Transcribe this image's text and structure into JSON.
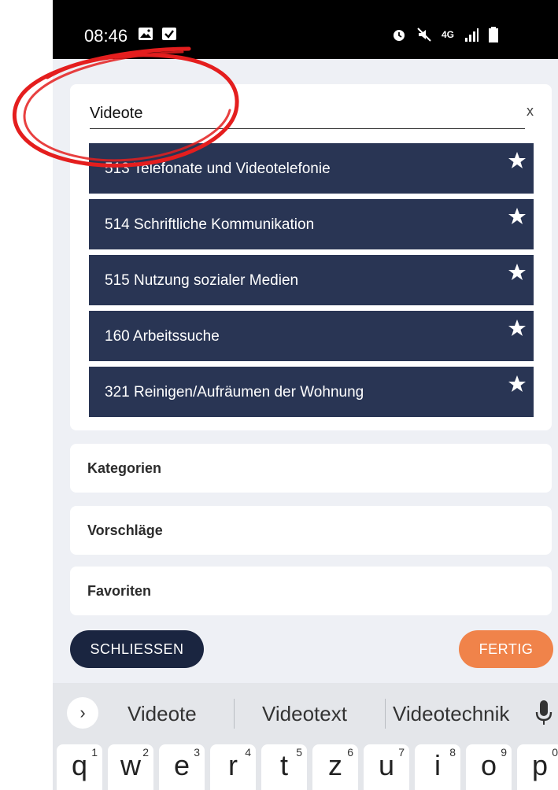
{
  "status_bar": {
    "time": "08:46",
    "left_icons": [
      "image-icon",
      "checkbox-icon"
    ],
    "right_icons": [
      "alarm-icon",
      "mute-icon",
      "network-4g-icon",
      "signal-icon",
      "battery-icon"
    ],
    "network_label": "4G"
  },
  "search": {
    "value": "Videote",
    "clear_label": "x"
  },
  "results": [
    {
      "label": "513 Telefonate und Videotelefonie"
    },
    {
      "label": "514 Schriftliche Kommunikation"
    },
    {
      "label": "515 Nutzung sozialer Medien"
    },
    {
      "label": "160 Arbeitssuche"
    },
    {
      "label": "321 Reinigen/Aufräumen der Wohnung"
    }
  ],
  "sections": {
    "categories": "Kategorien",
    "suggestions": "Vorschläge",
    "favorites": "Favoriten"
  },
  "buttons": {
    "close": "SCHLIESSEN",
    "done": "FERTIG"
  },
  "keyboard": {
    "expand_label": "›",
    "suggestions": [
      "Videote",
      "Videotext",
      "Videotechnik"
    ],
    "keys": [
      {
        "letter": "q",
        "num": "1"
      },
      {
        "letter": "w",
        "num": "2"
      },
      {
        "letter": "e",
        "num": "3"
      },
      {
        "letter": "r",
        "num": "4"
      },
      {
        "letter": "t",
        "num": "5"
      },
      {
        "letter": "z",
        "num": "6"
      },
      {
        "letter": "u",
        "num": "7"
      },
      {
        "letter": "i",
        "num": "8"
      },
      {
        "letter": "o",
        "num": "9"
      },
      {
        "letter": "p",
        "num": "0"
      }
    ]
  },
  "colors": {
    "result_bg": "#293554",
    "close_button": "#1a2540",
    "done_button": "#f0834a",
    "annotation": "#e41e1e"
  }
}
